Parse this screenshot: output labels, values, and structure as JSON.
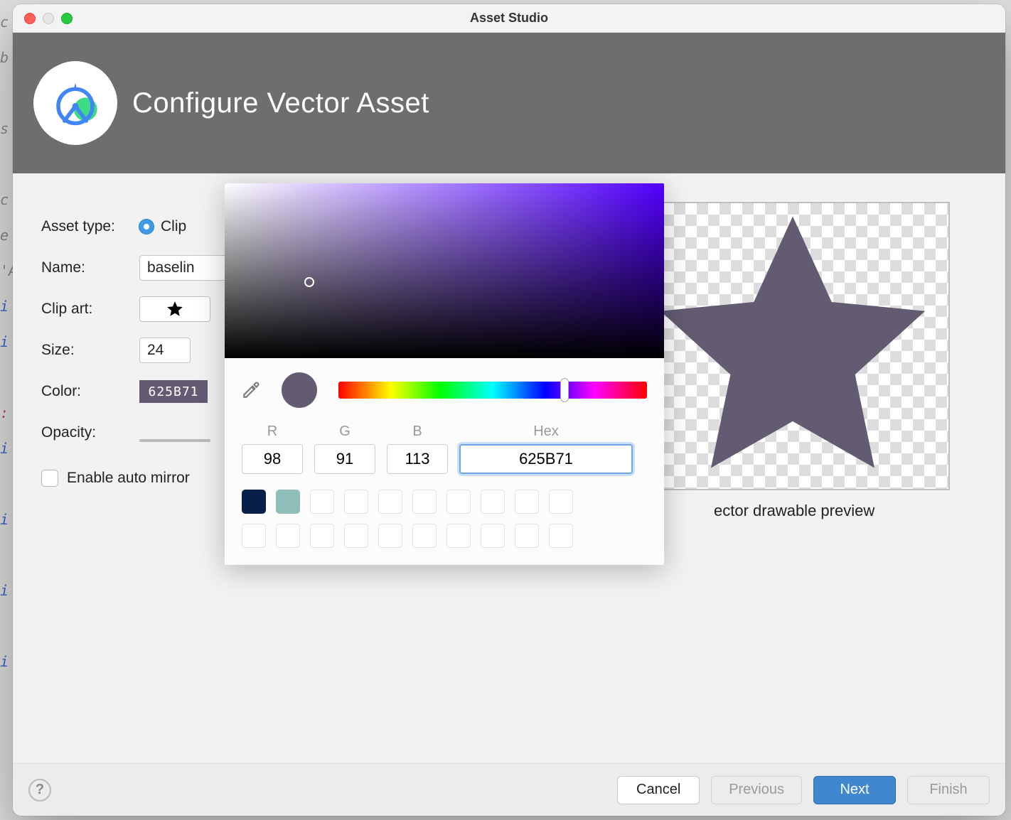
{
  "titlebar": {
    "title": "Asset Studio"
  },
  "header": {
    "title": "Configure Vector Asset"
  },
  "form": {
    "asset_type_label": "Asset type:",
    "asset_type_value": "Clip",
    "name_label": "Name:",
    "name_value": "baselin",
    "clipart_label": "Clip art:",
    "size_label": "Size:",
    "size_value": "24",
    "color_label": "Color:",
    "color_value": "625B71",
    "opacity_label": "Opacity:",
    "enable_mirror_label": "Enable auto mirror"
  },
  "preview": {
    "caption": "ector drawable preview",
    "star_color": "#625B71"
  },
  "picker": {
    "r_label": "R",
    "g_label": "G",
    "b_label": "B",
    "hex_label": "Hex",
    "r": "98",
    "g": "91",
    "b": "113",
    "hex": "625B71",
    "swatch_color": "#625B71",
    "palette": [
      "#081f4a",
      "#8fbdb8"
    ]
  },
  "footer": {
    "cancel": "Cancel",
    "previous": "Previous",
    "next": "Next",
    "finish": "Finish"
  }
}
